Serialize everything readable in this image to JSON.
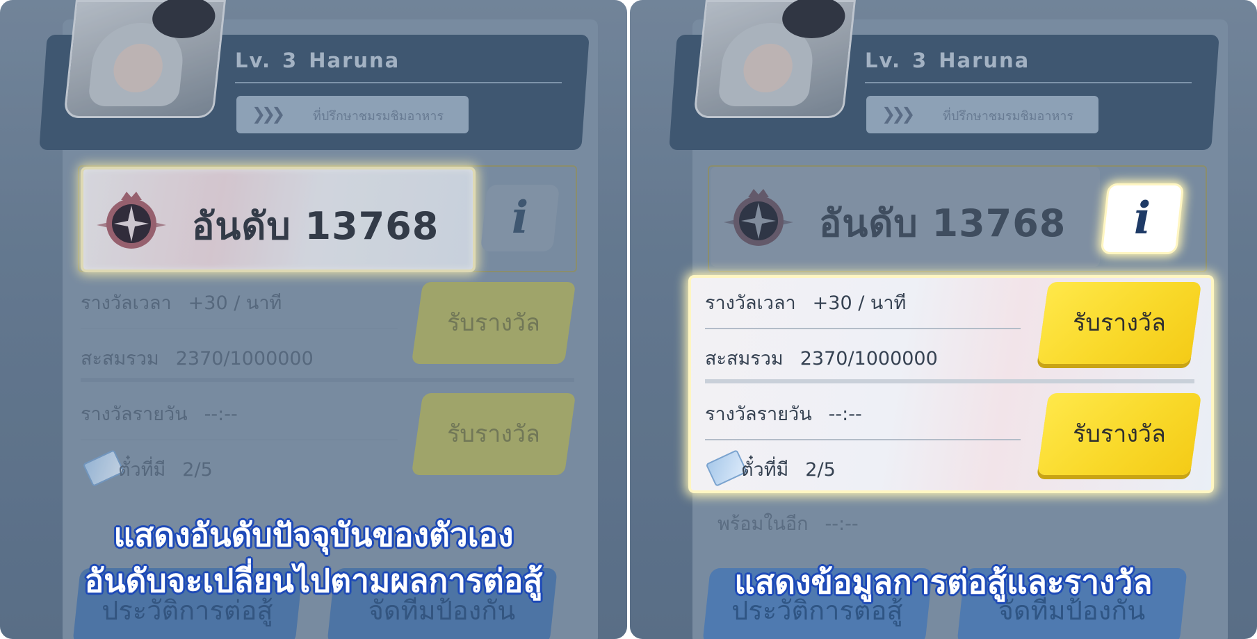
{
  "profile": {
    "level_label": "Lv.",
    "level": "3",
    "name": "Haruna",
    "subtitle": "ที่ปรึกษาชมรมชิมอาหาร"
  },
  "rank": {
    "label": "อันดับ 13768"
  },
  "info_button": {
    "glyph": "i"
  },
  "rewards": {
    "time_reward_label": "รางวัลเวลา",
    "time_reward_value": "+30 / นาที",
    "accumulated_label": "สะสมรวม",
    "accumulated_value": "2370/1000000",
    "daily_reward_label": "รางวัลรายวัน",
    "daily_reward_value": "--:--",
    "tickets_label": "ตั๋วที่มี",
    "tickets_value": "2/5",
    "ready_label": "พร้อมในอีก",
    "ready_value": "--:--",
    "claim_label": "รับรางวัล"
  },
  "bottom": {
    "history_label": "ประวัติการต่อสู้",
    "defense_label": "จัดทีมป้องกัน"
  },
  "captions": {
    "left_line1": "แสดงอันดับปัจจุบันของตัวเอง",
    "left_line2": "อันดับจะเปลี่ยนไปตามผลการต่อสู้",
    "right_line1": "แสดงข้อมูลการต่อสู้และรางวัล"
  },
  "icons": {
    "rank_emblem": "rank-emblem-icon",
    "info": "info-icon",
    "ticket": "ticket-icon",
    "title_wings": "wings-icon"
  },
  "colors": {
    "claim_yellow": "#f9d92a",
    "caption_outline": "#1f4bb8",
    "highlight_glow": "#fff4b3"
  }
}
